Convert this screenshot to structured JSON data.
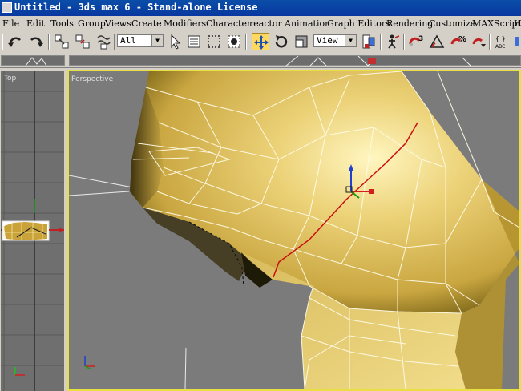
{
  "window": {
    "title": "Untitled - 3ds max 6 - Stand-alone License"
  },
  "menu": {
    "items": [
      "File",
      "Edit",
      "Tools",
      "Group",
      "Views",
      "Create",
      "Modifiers",
      "Character",
      "reactor",
      "Animation",
      "Graph Editors",
      "Rendering",
      "Customize",
      "MAXScript",
      "He"
    ]
  },
  "toolbar": {
    "selection_filter": "All",
    "reference_coord": "View",
    "icons": [
      "undo-icon",
      "redo-icon",
      "select-link-icon",
      "unlink-icon",
      "bind-spacewarp-icon",
      "select-object-icon",
      "select-by-name-icon",
      "rectangular-selection-icon",
      "window-crossing-icon",
      "select-move-icon",
      "select-rotate-icon",
      "select-scale-icon",
      "pivot-center-icon",
      "select-manipulate-icon",
      "snap-3d-icon",
      "angle-snap-icon",
      "percent-snap-icon",
      "spinner-snap-icon",
      "named-selection-icon",
      "mirror-icon"
    ],
    "snap_3d_label": "3",
    "percent_label": "%",
    "abc_label": "ABC"
  },
  "viewports": {
    "top_label": "Top",
    "perspective_label": "Perspective"
  },
  "colors": {
    "titlebar": "#0a4ea8",
    "ui_gray": "#d4d0c8",
    "viewport_bg": "#7b7b7b",
    "active_border": "#e8e040",
    "mesh_yellow": "#e8cf6a"
  }
}
